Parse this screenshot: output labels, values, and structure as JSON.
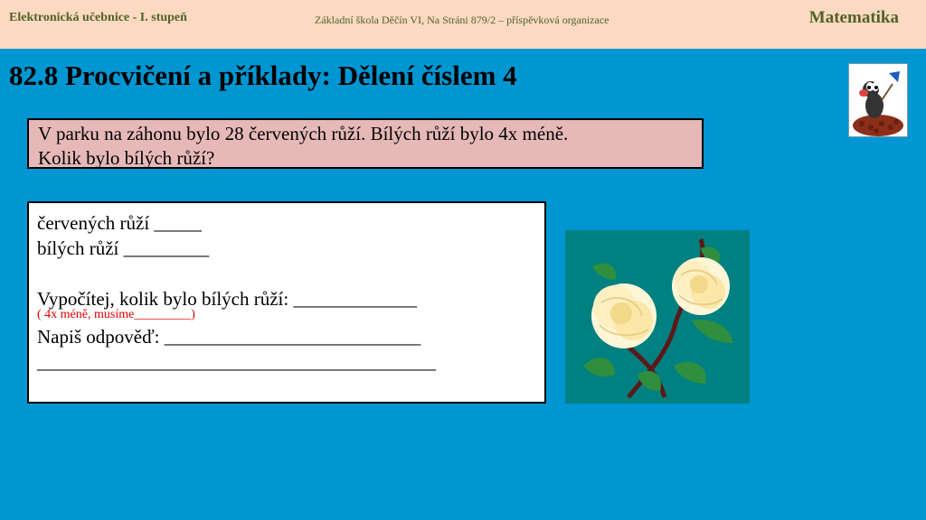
{
  "header": {
    "left": "Elektronická  učebnice - I. stupeň",
    "middle": "Základní škola Děčín VI, Na Stráni 879/2  – příspěvková organizace",
    "right": "Matematika"
  },
  "title": "82.8 Procvičení a příklady: Dělení číslem 4",
  "question": {
    "line1": "V parku na záhonu bylo 28 červených růží. Bílých růží bylo 4x méně.",
    "line2": "Kolik bylo bílých růží?"
  },
  "answer": {
    "line1": "červených růží _____",
    "line2": "bílých růží _________",
    "line3": "Vypočítej, kolik bylo bílých růží: _____________",
    "hint": "( 4x méně, musíme_________)",
    "line4": "Napiš odpověď: ___________________________",
    "line5": "__________________________________________"
  },
  "colors": {
    "background": "#0096d2",
    "header": "#fcd9c1",
    "question_box": "#e6b9b8",
    "hint_text": "#e00000"
  }
}
